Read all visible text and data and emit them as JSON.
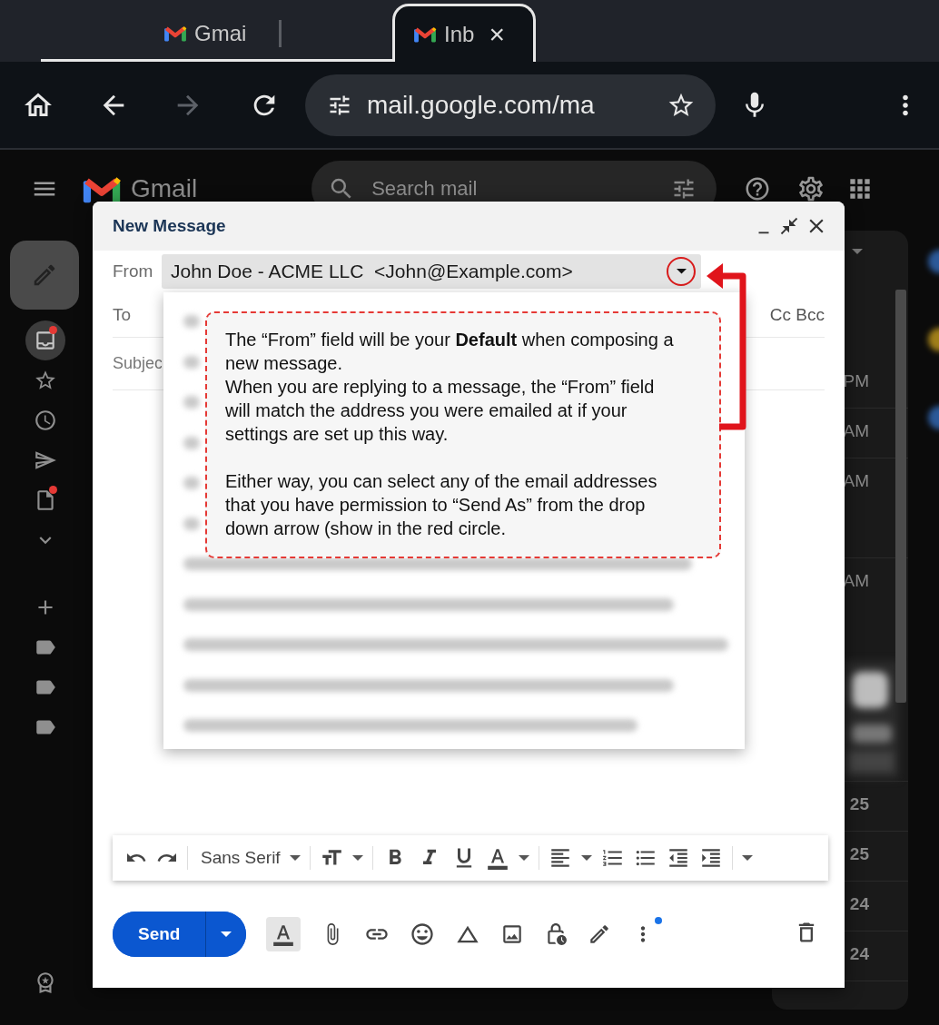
{
  "browser": {
    "tabs": [
      {
        "title": "Gmai",
        "selected": false
      },
      {
        "title": "Inb",
        "selected": true,
        "close": "×"
      }
    ],
    "forward_disabled": true,
    "address": "mail.google.com/ma"
  },
  "gmail": {
    "brand": "Gmail",
    "search": {
      "placeholder": "Search mail"
    },
    "sidebar": [
      {
        "kind": "inbox",
        "selected": true,
        "dot": true
      },
      {
        "kind": "starred",
        "selected": false,
        "dot": false
      },
      {
        "kind": "snoozed",
        "selected": false,
        "dot": false
      },
      {
        "kind": "sent",
        "selected": false,
        "dot": false
      },
      {
        "kind": "drafts",
        "selected": false,
        "dot": true
      },
      {
        "kind": "more",
        "selected": false,
        "dot": false
      },
      {
        "kind": "new-label",
        "selected": false,
        "dot": false
      },
      {
        "kind": "label",
        "selected": false,
        "dot": false
      },
      {
        "kind": "label",
        "selected": false,
        "dot": false
      },
      {
        "kind": "label",
        "selected": false,
        "dot": false
      }
    ],
    "inbox_rows": [
      {
        "kind": "compact",
        "time": "PM"
      },
      {
        "kind": "compact",
        "time": "AM"
      },
      {
        "kind": "attachments",
        "time": "AM"
      },
      {
        "kind": "preview",
        "time": "AM"
      },
      {
        "kind": "compact",
        "time": "25"
      },
      {
        "kind": "compact",
        "time": "25"
      },
      {
        "kind": "compact",
        "time": "24"
      },
      {
        "kind": "compact",
        "time": "24"
      }
    ]
  },
  "compose": {
    "title": "New Message",
    "from_label": "From",
    "from_value": "John Doe - ACME LLC  <John@Example.com>",
    "to_label": "To",
    "cc_bcc": "Cc Bcc",
    "subject_placeholder": "Subjec",
    "from_options": [
      {
        "kind": "covered"
      },
      {
        "kind": "covered"
      },
      {
        "kind": "covered"
      },
      {
        "kind": "covered"
      },
      {
        "kind": "covered"
      },
      {
        "kind": "covered"
      },
      {
        "kind": "blurred"
      },
      {
        "kind": "blurred"
      },
      {
        "kind": "blurred"
      },
      {
        "kind": "blurred"
      },
      {
        "kind": "blurred"
      }
    ],
    "font": "Sans Serif",
    "send": "Send",
    "formatting_selected": true,
    "more_dot": true
  },
  "callout": {
    "blocks": [
      [
        "The “From” field will be your **Default** when composing a new message.",
        "When you are replying to a message, the “From” field will match the address you were emailed at if your settings are set up this way."
      ],
      [
        "Either way, you can select any of the email addresses that you have permission to “Send As” from the drop down arrow (show in the red circle."
      ]
    ]
  }
}
